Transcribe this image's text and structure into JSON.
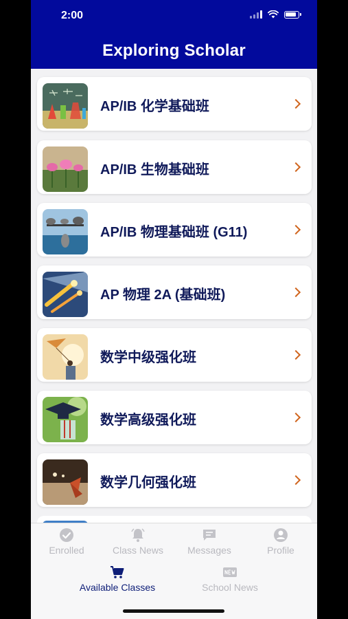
{
  "status_bar": {
    "time": "2:00"
  },
  "header": {
    "title": "Exploring Scholar"
  },
  "classes": [
    {
      "label": "AP/IB 化学基础班"
    },
    {
      "label": "AP/IB 生物基础班"
    },
    {
      "label": "AP/IB 物理基础班 (G11)"
    },
    {
      "label": "AP 物理 2A (基础班)"
    },
    {
      "label": "数学中级强化班"
    },
    {
      "label": "数学高级强化班"
    },
    {
      "label": "数学几何强化班"
    }
  ],
  "tabs": {
    "enrolled": "Enrolled",
    "class_news": "Class News",
    "messages": "Messages",
    "profile": "Profile",
    "available_classes": "Available Classes",
    "school_news": "School News"
  },
  "colors": {
    "header_bg": "#020a9c",
    "class_title": "#101a5a",
    "chevron": "#d0651e",
    "active_tab": "#0d1d77",
    "inactive_tab": "#b9b9bf"
  }
}
